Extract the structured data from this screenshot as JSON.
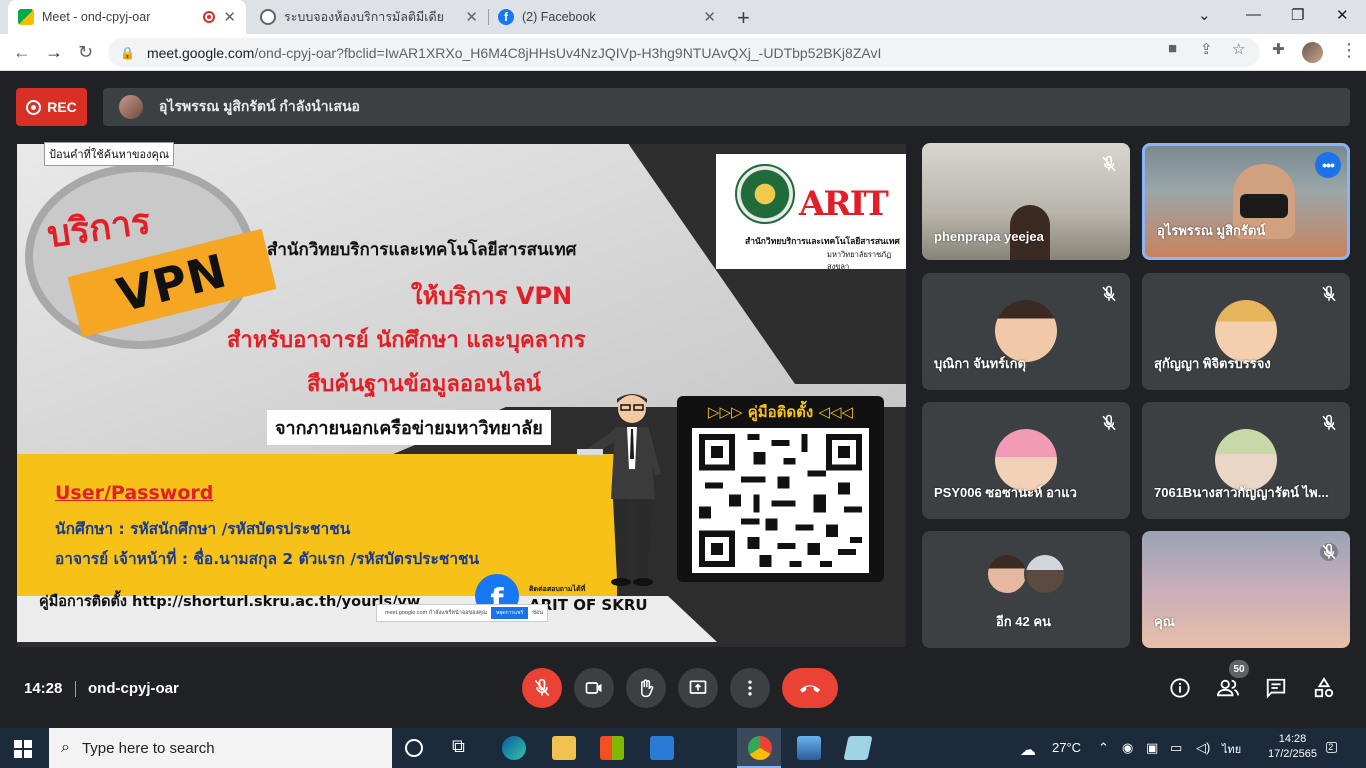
{
  "browser": {
    "tabs": [
      {
        "title": "Meet - ond-cpyj-oar",
        "recording": true
      },
      {
        "title": "ระบบจองห้องบริการมัลติมีเดีย"
      },
      {
        "title": "(2) Facebook"
      }
    ],
    "new_tab": "+",
    "url_host": "meet.google.com",
    "url_path": "/ond-cpyj-oar?fbclid=IwAR1XRXo_H6M4C8jHHsUv4NzJQIVp-H3hg9NTUAvQXj_-UDTbp52BKj8ZAvI"
  },
  "meet": {
    "rec_label": "REC",
    "presenting_text": "อุไรพรรณ มูสิกรัตน์ กำลังนำเสนอ",
    "tooltip": "ป้อนคำที่ใช้ค้นหาของคุณ",
    "slide": {
      "brand_word": "บริการ",
      "vpn": "VPN",
      "org": "สำนักวิทยบริการและเทคโนโลยีสารสนเทศ",
      "service": "ให้บริการ VPN",
      "for_whom": "สำหรับอาจารย์ นักศึกษา และบุคลากร",
      "search": "สืบค้นฐานข้อมูลออนไลน์",
      "outside": "จากภายนอกเครือข่ายมหาวิทยาลัย",
      "userpw": "User/Password",
      "student": "นักศึกษา : รหัสนักศึกษา /รหัสบัตรประชาชน",
      "staff": "อาจารย์ เจ้าหน้าที่ : ชื่อ.นามสกุล 2 ตัวแรก /รหัสบัตรประชาชน",
      "guide": "คู่มือการติดตั้ง   http://shorturl.skru.ac.th/yourls/vw",
      "fb_page": "ARIT OF SKRU",
      "fb_contact": "ติดต่อสอบถามได้ที่",
      "qr_title": "▷▷▷  คู่มือติดตั้ง  ◁◁◁",
      "logo_text": "ARIT",
      "logo_caption1": "สำนักวิทยบริการและเทคโนโลยีสารสนเทศ",
      "logo_caption2": "มหาวิทยาลัยราชภัฏสงขลา"
    },
    "share_notice": {
      "text": "meet.google.com กำลังแชร์หน้าจอของคุณ",
      "stop": "หยุดการแชร์",
      "hide": "ซ่อน"
    },
    "tiles": [
      {
        "name": "phenprapa yeejea"
      },
      {
        "name": "อุไรพรรณ มูสิกรัตน์",
        "more": "•••"
      },
      {
        "name": "บุณิกา จันทร์เกตุ"
      },
      {
        "name": "สุกัญญา พิจิตรบรรจง"
      },
      {
        "name": "PSY006 ซอซานะห์ อาแว"
      },
      {
        "name": "7061Bนางสาวกัญญารัตน์ ไพ..."
      },
      {
        "name": "อีก 42 คน"
      },
      {
        "name": "คุณ"
      }
    ],
    "time": "14:28",
    "meeting_code": "ond-cpyj-oar",
    "participants_count": "50",
    "colors": {
      "red": "#ea4335",
      "dark": "#202124",
      "tile": "#3c4043",
      "highlight": "#8ab4f8"
    }
  },
  "taskbar": {
    "search_placeholder": "Type here to search",
    "weather": "27°C",
    "lang": "ไทย",
    "clock_time": "14:28",
    "clock_date": "17/2/2565",
    "notifications": "2"
  }
}
